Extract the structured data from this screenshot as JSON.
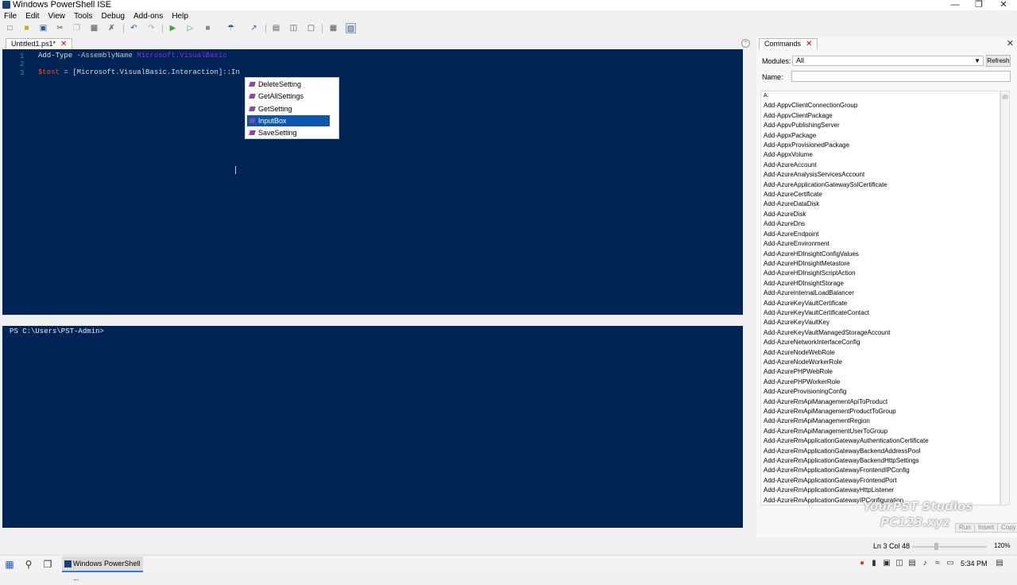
{
  "window": {
    "title": "Windows PowerShell ISE"
  },
  "menu": [
    "File",
    "Edit",
    "View",
    "Tools",
    "Debug",
    "Add-ons",
    "Help"
  ],
  "tabs": {
    "script_tab": "Untitled1.ps1*"
  },
  "editor": {
    "line1": {
      "cmd": "Add-Type",
      "param": "-AssemblyName",
      "arg": "Microsoft.VisualBasic"
    },
    "line3": {
      "var": "$test",
      "rest": " = [Microsoft.VisualBasic.Interaction]::In"
    }
  },
  "intellisense": {
    "items": [
      "DeleteSetting",
      "GetAllSettings",
      "GetSetting",
      "InputBox",
      "SaveSetting"
    ],
    "selected": "InputBox"
  },
  "console": {
    "prompt": "PS C:\\Users\\PST-Admin>"
  },
  "commands_pane": {
    "tab": "Commands",
    "modules_label": "Modules:",
    "modules_value": "All",
    "refresh_label": "Refresh",
    "name_label": "Name:",
    "group_header": "A:",
    "items": [
      "Add-AppvClientConnectionGroup",
      "Add-AppvClientPackage",
      "Add-AppvPublishingServer",
      "Add-AppxPackage",
      "Add-AppxProvisionedPackage",
      "Add-AppxVolume",
      "Add-AzureAccount",
      "Add-AzureAnalysisServicesAccount",
      "Add-AzureApplicationGatewaySslCertificate",
      "Add-AzureCertificate",
      "Add-AzureDataDisk",
      "Add-AzureDisk",
      "Add-AzureDns",
      "Add-AzureEndpoint",
      "Add-AzureEnvironment",
      "Add-AzureHDInsightConfigValues",
      "Add-AzureHDInsightMetastore",
      "Add-AzureHDInsightScriptAction",
      "Add-AzureHDInsightStorage",
      "Add-AzureInternalLoadBalancer",
      "Add-AzureKeyVaultCertificate",
      "Add-AzureKeyVaultCertificateContact",
      "Add-AzureKeyVaultKey",
      "Add-AzureKeyVaultManagedStorageAccount",
      "Add-AzureNetworkInterfaceConfig",
      "Add-AzureNodeWebRole",
      "Add-AzureNodeWorkerRole",
      "Add-AzurePHPWebRole",
      "Add-AzurePHPWorkerRole",
      "Add-AzureProvisioningConfig",
      "Add-AzureRmApiManagementApiToProduct",
      "Add-AzureRmApiManagementProductToGroup",
      "Add-AzureRmApiManagementRegion",
      "Add-AzureRmApiManagementUserToGroup",
      "Add-AzureRmApplicationGatewayAuthenticationCertificate",
      "Add-AzureRmApplicationGatewayBackendAddressPool",
      "Add-AzureRmApplicationGatewayBackendHttpSettings",
      "Add-AzureRmApplicationGatewayFrontendIPConfig",
      "Add-AzureRmApplicationGatewayFrontendPort",
      "Add-AzureRmApplicationGatewayHttpListener",
      "Add-AzureRmApplicationGatewayIPConfiguration"
    ],
    "run_label": "Run",
    "insert_label": "Insert",
    "copy_label": "Copy"
  },
  "watermark": {
    "line1": "YourPST Studios",
    "line2": "PC123.xyz"
  },
  "statusbar": {
    "position": "Ln 3  Col 48",
    "zoom": "120%"
  },
  "taskbar": {
    "app": "Windows PowerShell ...",
    "clock": "5:34 PM"
  }
}
